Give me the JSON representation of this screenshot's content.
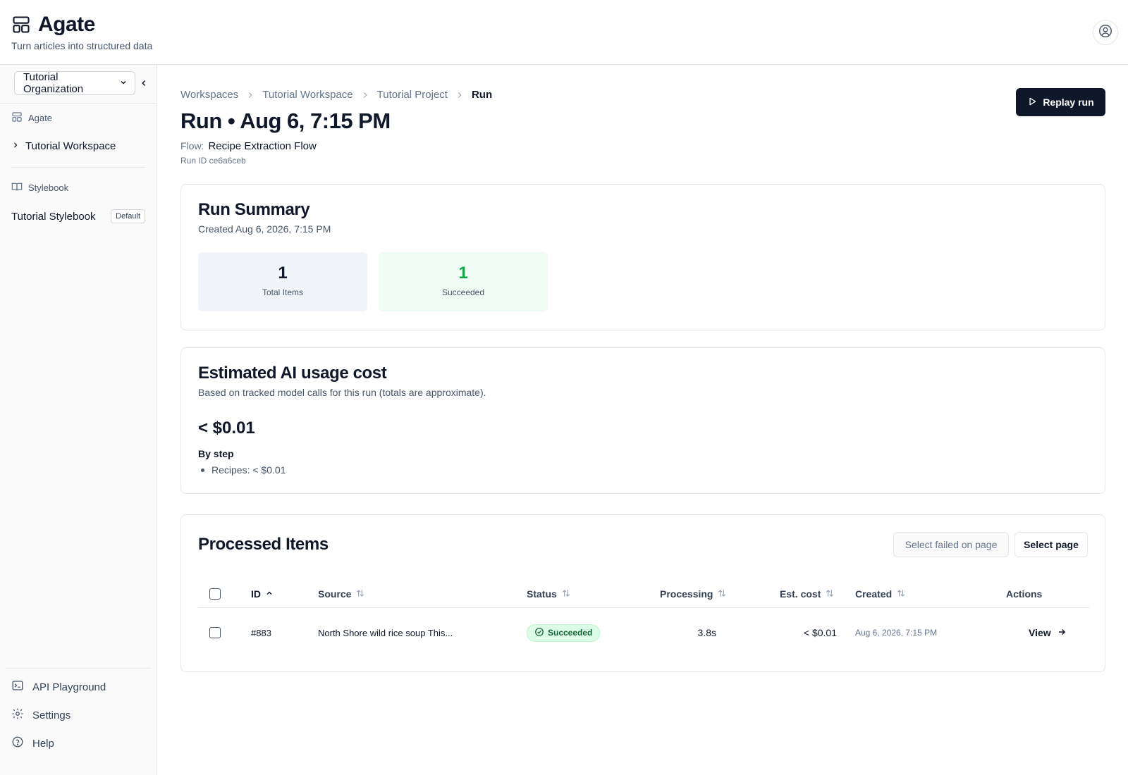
{
  "header": {
    "app_name": "Agate",
    "tagline": "Turn articles into structured data",
    "icons": {
      "logo": "layout-icon",
      "user": "user-circle-icon"
    }
  },
  "sidebar": {
    "org_select": {
      "value": "Tutorial Organization"
    },
    "sections": {
      "agate_label": "Agate",
      "stylebook_label": "Stylebook"
    },
    "workspace_item": "Tutorial Workspace",
    "stylebook_item": "Tutorial Stylebook",
    "stylebook_badge": "Default",
    "bottom": {
      "api": "API Playground",
      "settings": "Settings",
      "help": "Help"
    }
  },
  "breadcrumb": {
    "items": [
      "Workspaces",
      "Tutorial Workspace",
      "Tutorial Project"
    ],
    "current": "Run"
  },
  "page": {
    "title": "Run • Aug 6, 7:15 PM",
    "flow_label": "Flow:",
    "flow_name": "Recipe Extraction Flow",
    "run_id": "Run ID ce6a6ceb",
    "replay_label": "Replay run"
  },
  "summary": {
    "title": "Run Summary",
    "created": "Created Aug 6, 2026, 7:15 PM",
    "stats": [
      {
        "value": "1",
        "label": "Total Items",
        "color": "#0f172a",
        "bg": "#f1f5f9"
      },
      {
        "value": "1",
        "label": "Succeeded",
        "color": "#16a34a",
        "bg": "#f0fdf4"
      }
    ]
  },
  "cost": {
    "title": "Estimated AI usage cost",
    "subtitle": "Based on tracked model calls for this run (totals are approximate).",
    "total": "< $0.01",
    "by_step_label": "By step",
    "steps": [
      "Recipes: < $0.01"
    ]
  },
  "items": {
    "title": "Processed Items",
    "select_failed_label": "Select failed on page",
    "select_page_label": "Select page",
    "columns": {
      "id": "ID",
      "source": "Source",
      "status": "Status",
      "processing": "Processing",
      "cost": "Est. cost",
      "created": "Created",
      "actions": "Actions"
    },
    "rows": [
      {
        "id": "#883",
        "source": "North Shore wild rice soup This...",
        "status": "Succeeded",
        "processing": "3.8s",
        "cost": "< $0.01",
        "created": "Aug 6, 2026, 7:15 PM",
        "action": "View"
      }
    ]
  }
}
